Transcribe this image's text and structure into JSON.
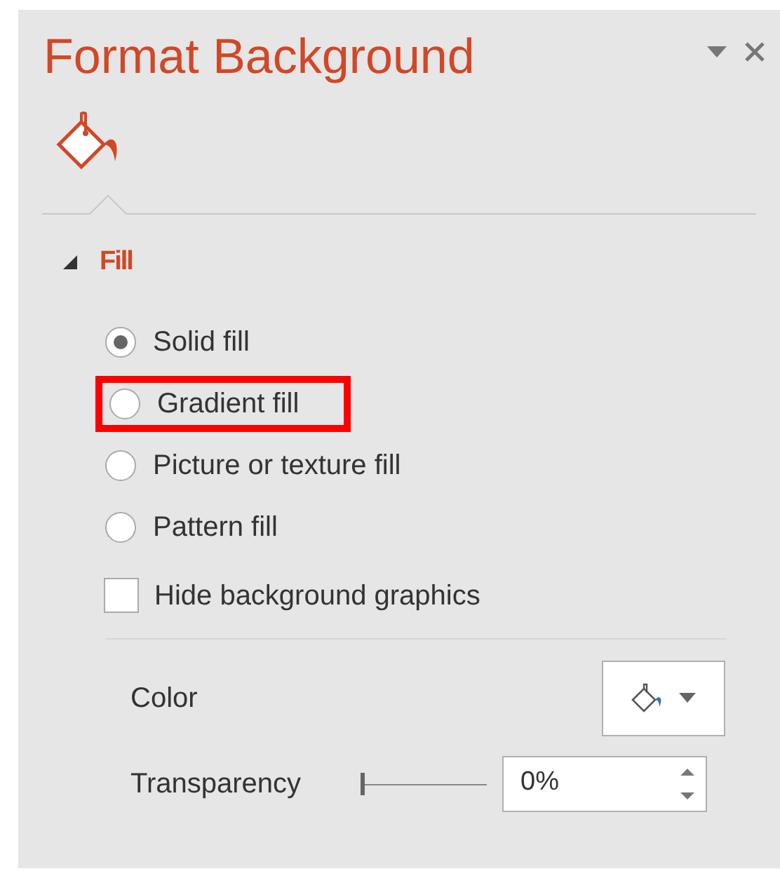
{
  "pane": {
    "title": "Format Background"
  },
  "section": {
    "title": "Fill",
    "expanded": true
  },
  "fill_options": [
    {
      "label": "Solid fill",
      "selected": true,
      "highlighted": false
    },
    {
      "label": "Gradient fill",
      "selected": false,
      "highlighted": true
    },
    {
      "label": "Picture or texture fill",
      "selected": false,
      "highlighted": false
    },
    {
      "label": "Pattern fill",
      "selected": false,
      "highlighted": false
    }
  ],
  "hide_background_graphics": {
    "label": "Hide background graphics",
    "checked": false
  },
  "color": {
    "label": "Color"
  },
  "transparency": {
    "label": "Transparency",
    "level": 0,
    "value": "0%"
  }
}
